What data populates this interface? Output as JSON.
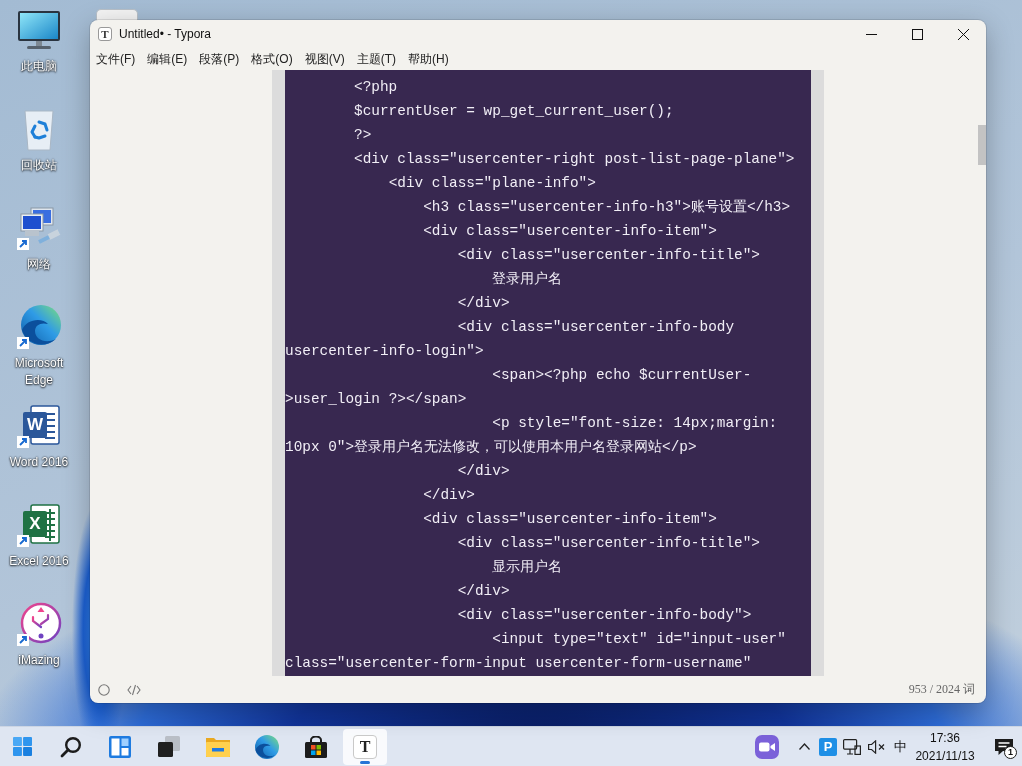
{
  "desktop_icons": [
    {
      "label": "此电脑",
      "kind": "computer"
    },
    {
      "label": "回收站",
      "kind": "recycle_bin"
    },
    {
      "label": "网络",
      "kind": "network"
    },
    {
      "label": "Microsoft Edge",
      "kind": "edge"
    },
    {
      "label": "Word 2016",
      "kind": "word",
      "glyph": "W"
    },
    {
      "label": "Excel 2016",
      "kind": "excel",
      "glyph": "X"
    },
    {
      "label": "iMazing",
      "kind": "imazing"
    }
  ],
  "window": {
    "app_glyph": "T",
    "title": "Untitled• - Typora"
  },
  "menu": [
    "文件(F)",
    "编辑(E)",
    "段落(P)",
    "格式(O)",
    "视图(V)",
    "主题(T)",
    "帮助(H)"
  ],
  "code_lines": [
    "        <?php",
    "        $currentUser = wp_get_current_user();",
    "        ?>",
    "        <div class=\"usercenter-right post-list-page-plane\">",
    "            <div class=\"plane-info\">",
    "                <h3 class=\"usercenter-info-h3\">账号设置</h3>",
    "                <div class=\"usercenter-info-item\">",
    "                    <div class=\"usercenter-info-title\">",
    "                        登录用户名",
    "                    </div>",
    "                    <div class=\"usercenter-info-body",
    "usercenter-info-login\">",
    "                        <span><?php echo $currentUser-",
    ">user_login ?></span>",
    "                        <p style=\"font-size: 14px;margin:",
    "10px 0\">登录用户名无法修改，可以使用本用户名登录网站</p>",
    "                    </div>",
    "                </div>",
    "                <div class=\"usercenter-info-item\">",
    "                    <div class=\"usercenter-info-title\">",
    "                        显示用户名",
    "                    </div>",
    "                    <div class=\"usercenter-info-body\">",
    "                        <input type=\"text\" id=\"input-user\"",
    "class=\"usercenter-form-input usercenter-form-username\""
  ],
  "status_bar": {
    "word_count": "953 / 2024 词"
  },
  "taskbar": {
    "apps": [
      {
        "kind": "start",
        "selected": false
      },
      {
        "kind": "search",
        "selected": false
      },
      {
        "kind": "widgets",
        "selected": false
      },
      {
        "kind": "task_view",
        "selected": false
      },
      {
        "kind": "explorer",
        "selected": false
      },
      {
        "kind": "edge",
        "selected": false
      },
      {
        "kind": "store",
        "selected": false
      },
      {
        "kind": "typora",
        "glyph": "T",
        "selected": true
      }
    ],
    "tray": [
      {
        "kind": "meet"
      },
      {
        "kind": "chevron"
      },
      {
        "kind": "letter",
        "glyph": "P"
      },
      {
        "kind": "network"
      },
      {
        "kind": "volume_muted"
      },
      {
        "kind": "language",
        "label": "中"
      }
    ],
    "clock": {
      "time": "17:36",
      "date": "2021/11/13"
    },
    "notifications": {
      "count": "1"
    }
  }
}
